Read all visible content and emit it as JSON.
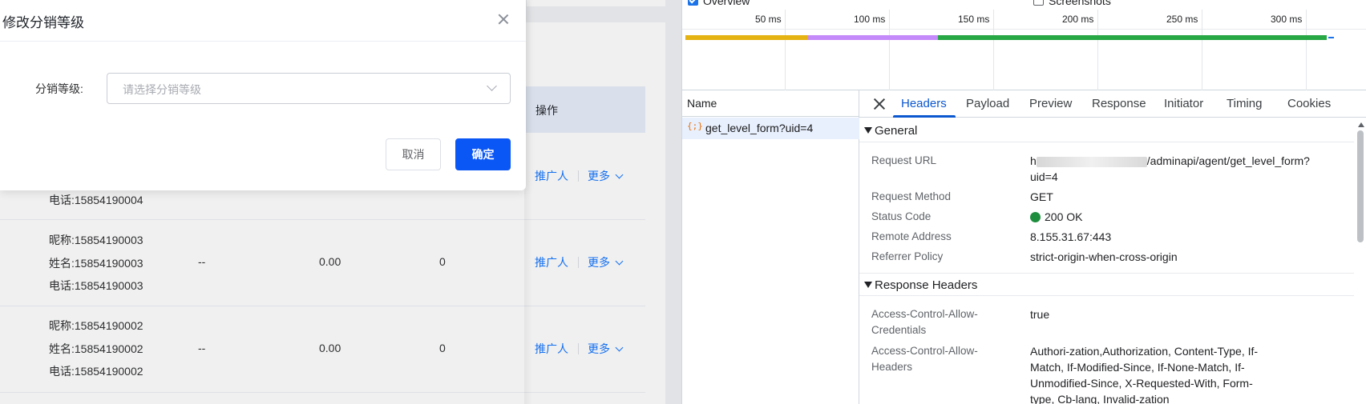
{
  "app": {
    "table": {
      "op_header": "操作",
      "rows": [
        {
          "lines": [
            "电话:15854190004"
          ],
          "promoter": "推广人",
          "more": "更多"
        },
        {
          "lines": [
            "昵称:15854190003",
            "姓名:15854190003",
            "电话:15854190003"
          ],
          "level": "--",
          "amount": "0.00",
          "count": "0",
          "promoter": "推广人",
          "more": "更多"
        },
        {
          "lines": [
            "昵称:15854190002",
            "姓名:15854190002",
            "电话:15854190002"
          ],
          "level": "--",
          "amount": "0.00",
          "count": "0",
          "promoter": "推广人",
          "more": "更多"
        }
      ]
    },
    "modal": {
      "title": "修改分销等级",
      "field_label": "分销等级:",
      "select_placeholder": "请选择分销等级",
      "cancel_label": "取消",
      "ok_label": "确定"
    }
  },
  "devtools": {
    "checkboxes": [
      {
        "label": "Overview",
        "checked": true
      },
      {
        "label": "Screenshots",
        "checked": false
      }
    ],
    "timeline": {
      "ticks": [
        "50 ms",
        "100 ms",
        "150 ms",
        "200 ms",
        "250 ms",
        "300 ms"
      ],
      "segment_colors": [
        "#e5b312",
        "#c58af9",
        "#28a745"
      ]
    },
    "requests": {
      "column_name": "Name",
      "items": [
        {
          "icon": "{;}",
          "name": "get_level_form?uid=4"
        }
      ]
    },
    "tabs": [
      "Headers",
      "Payload",
      "Preview",
      "Response",
      "Initiator",
      "Timing",
      "Cookies"
    ],
    "active_tab": "Headers",
    "general": {
      "title": "General",
      "request_url_label": "Request URL",
      "request_url_value": "/adminapi/agent/get_level_form?",
      "request_url_value_2": "uid=4",
      "request_method_label": "Request Method",
      "request_method_value": "GET",
      "status_code_label": "Status Code",
      "status_code_value": "200 OK",
      "status_color": "#1e8e3e",
      "remote_address_label": "Remote Address",
      "remote_address_value": "8.155.31.67:443",
      "referrer_policy_label": "Referrer Policy",
      "referrer_policy_value": "strict-origin-when-cross-origin"
    },
    "response_headers": {
      "title": "Response Headers",
      "acac_label_1": "Access-Control-Allow-",
      "acac_label_2": "Credentials",
      "acac_value": "true",
      "acah_label_1": "Access-Control-Allow-",
      "acah_label_2": "Headers",
      "acah_value_1": "Authori-zation,Authorization, Content-Type, If-",
      "acah_value_2": "Match, If-Modified-Since, If-None-Match, If-",
      "acah_value_3": "Unmodified-Since, X-Requested-With, Form-",
      "acah_value_4": "type, Cb-lang, Invalid-zation"
    }
  }
}
